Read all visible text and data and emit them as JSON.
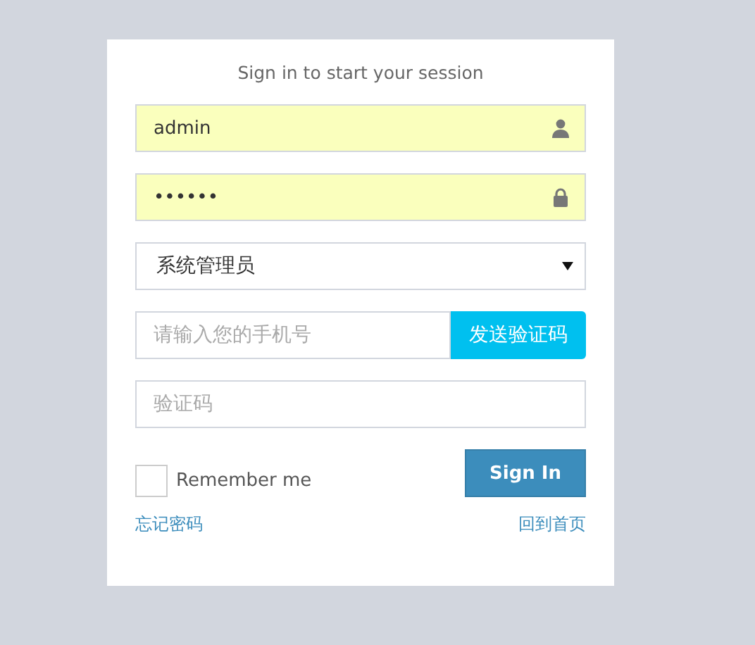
{
  "title": "Sign in to start your session",
  "username": {
    "value": "admin",
    "autofilled": true
  },
  "password": {
    "value": "••••••",
    "autofilled": true
  },
  "role": {
    "value": "系统管理员"
  },
  "phone": {
    "placeholder": "请输入您的手机号",
    "button": "发送验证码"
  },
  "code": {
    "placeholder": "验证码"
  },
  "remember": {
    "label": "Remember me",
    "checked": false
  },
  "sign_in": "Sign In",
  "links": [
    "忘记密码",
    "回到首页"
  ]
}
